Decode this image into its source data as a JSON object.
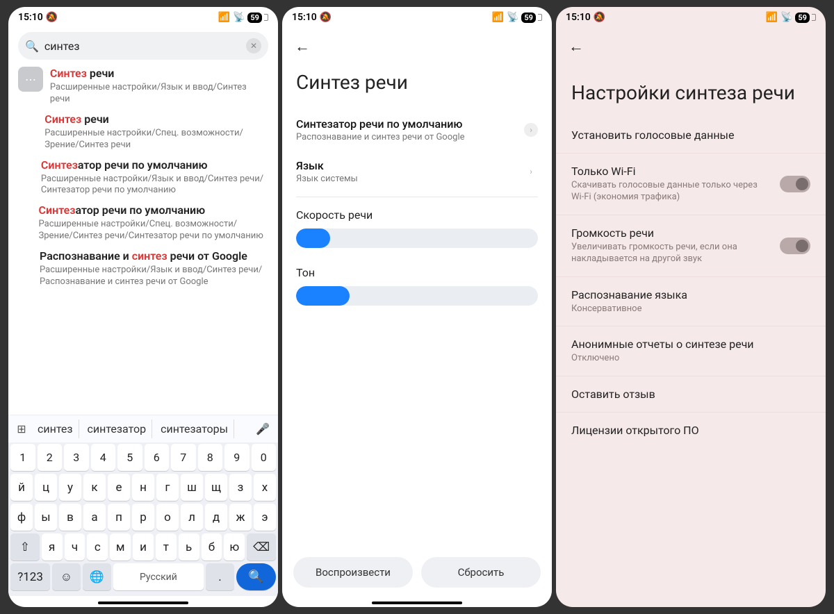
{
  "status": {
    "time": "15:10",
    "battery": "59"
  },
  "p1": {
    "search_value": "синтез",
    "results": [
      {
        "title_pre": "Синтез",
        "title_post": " речи",
        "path": "Расширенные настройки/Язык и ввод/Синтез речи"
      },
      {
        "title_pre": "Синтез",
        "title_post": " речи",
        "path": "Расширенные настройки/Спец. возможности/Зрение/Синтез речи"
      },
      {
        "title_pre": "Синтез",
        "title_post": "атор речи по умолчанию",
        "path": "Расширенные настройки/Язык и ввод/Синтез речи/Синтезатор речи по умолчанию"
      },
      {
        "title_pre": "Синтез",
        "title_post": "атор речи по умолчанию",
        "path": "Расширенные настройки/Спец. возможности/Зрение/Синтез речи/Синтезатор речи по умолчанию"
      },
      {
        "title_plain_pre": "Распознавание и ",
        "title_hl": "синтез",
        "title_plain_post": " речи от Google",
        "path": "Расширенные настройки/Язык и ввод/Синтез речи/Распознавание и синтез речи от Google"
      }
    ],
    "suggestions": [
      "синтез",
      "синтезатор",
      "синтезаторы"
    ],
    "kbd": {
      "row1": [
        "1",
        "2",
        "3",
        "4",
        "5",
        "6",
        "7",
        "8",
        "9",
        "0"
      ],
      "row2": [
        "й",
        "ц",
        "у",
        "к",
        "е",
        "н",
        "г",
        "ш",
        "щ",
        "з",
        "х"
      ],
      "row3": [
        "ф",
        "ы",
        "в",
        "а",
        "п",
        "р",
        "о",
        "л",
        "д",
        "ж",
        "э"
      ],
      "row4": [
        "я",
        "ч",
        "с",
        "м",
        "и",
        "т",
        "ь",
        "б",
        "ю"
      ],
      "mode_key": "?123",
      "lang_label": "Русский"
    }
  },
  "p2": {
    "title": "Синтез речи",
    "engine": {
      "label": "Синтезатор речи по умолчанию",
      "sub": "Распознавание и синтез речи от Google"
    },
    "lang": {
      "label": "Язык",
      "sub": "Язык системы"
    },
    "rate": {
      "label": "Скорость речи",
      "value_pct": 14
    },
    "pitch": {
      "label": "Тон",
      "value_pct": 22
    },
    "play": "Воспроизвести",
    "reset": "Сбросить"
  },
  "p3": {
    "title": "Настройки синтеза речи",
    "items": {
      "install": {
        "label": "Установить голосовые данные"
      },
      "wifi": {
        "label": "Только Wi-Fi",
        "sub": "Скачивать голосовые данные только через Wi-Fi (экономия трафика)"
      },
      "volume": {
        "label": "Громкость речи",
        "sub": "Увеличивать громкость речи, если она накладывается на другой звук"
      },
      "detect": {
        "label": "Распознавание языка",
        "sub": "Консервативное"
      },
      "anon": {
        "label": "Анонимные отчеты о синтезе речи",
        "sub": "Отключено"
      },
      "feedback": {
        "label": "Оставить отзыв"
      },
      "licenses": {
        "label": "Лицензии открытого ПО"
      }
    }
  }
}
